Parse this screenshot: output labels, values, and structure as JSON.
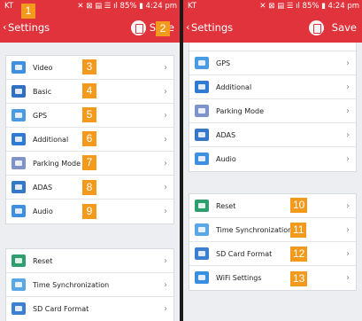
{
  "status": {
    "carrier": "KT",
    "icons_left": "✕ ⊠ ▤ ☰ ıl 85% ▮ 4:24 pm",
    "icons_right": "✕ ⊠ ▤ ☰ ıl 85% ▮ 4:24 pm"
  },
  "header": {
    "back_glyph": "‹",
    "title": "Settings",
    "save_label": "Save"
  },
  "chevron": "›",
  "left": {
    "group1": [
      {
        "label": "Video",
        "icon": "video-icon",
        "badge": "3"
      },
      {
        "label": "Basic",
        "icon": "basic-settings-icon",
        "badge": "4"
      },
      {
        "label": "GPS",
        "icon": "gps-icon",
        "badge": "5"
      },
      {
        "label": "Additional",
        "icon": "additional-settings-icon",
        "badge": "6"
      },
      {
        "label": "Parking Mode",
        "icon": "parking-mode-icon",
        "badge": "7"
      },
      {
        "label": "ADAS",
        "icon": "adas-icon",
        "badge": "8"
      },
      {
        "label": "Audio",
        "icon": "audio-icon",
        "badge": "9"
      }
    ],
    "group2": [
      {
        "label": "Reset",
        "icon": "reset-icon"
      },
      {
        "label": "Time Synchronization",
        "icon": "clock-icon"
      },
      {
        "label": "SD Card Format",
        "icon": "sd-card-icon"
      }
    ],
    "badge_back": "1",
    "badge_save": "2"
  },
  "right": {
    "group1": [
      {
        "label": "GPS",
        "icon": "gps-icon"
      },
      {
        "label": "Additional",
        "icon": "additional-settings-icon"
      },
      {
        "label": "Parking Mode",
        "icon": "parking-mode-icon"
      },
      {
        "label": "ADAS",
        "icon": "adas-icon"
      },
      {
        "label": "Audio",
        "icon": "audio-icon"
      }
    ],
    "group2": [
      {
        "label": "Reset",
        "icon": "reset-icon",
        "badge": "10"
      },
      {
        "label": "Time Synchronization",
        "icon": "clock-icon",
        "badge": "11"
      },
      {
        "label": "SD Card Format",
        "icon": "sd-card-icon",
        "badge": "12"
      },
      {
        "label": "WiFi Settings",
        "icon": "wifi-icon",
        "badge": "13"
      }
    ]
  },
  "colors": {
    "header_red": "#e0333c",
    "badge_orange": "#f39a1c",
    "background": "#eceef1"
  }
}
